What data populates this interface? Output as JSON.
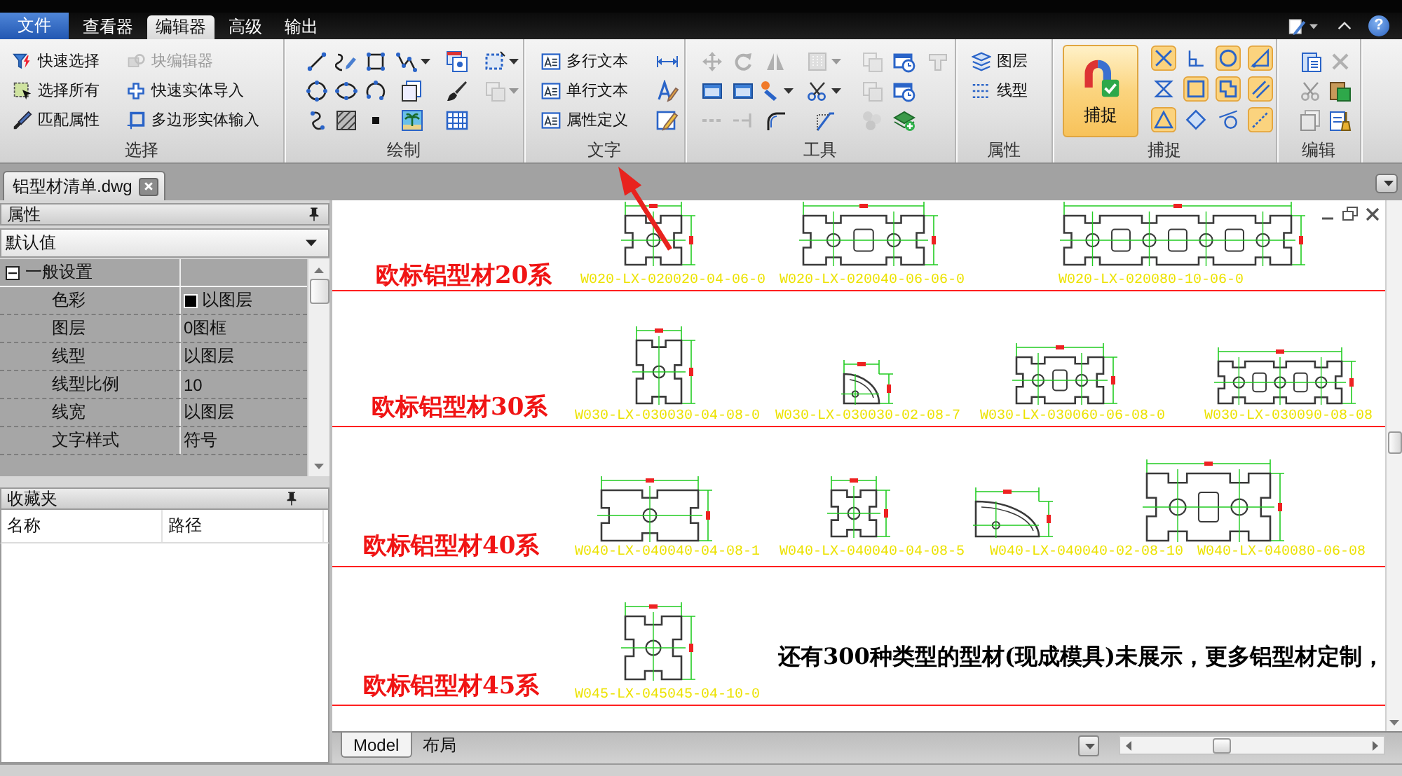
{
  "ribbon": {
    "file_menu": {
      "label": "文件"
    },
    "tabs": [
      {
        "label": "查看器",
        "selected": false
      },
      {
        "label": "编辑器",
        "selected": true
      },
      {
        "label": "高级",
        "selected": false
      },
      {
        "label": "输出",
        "selected": false
      }
    ],
    "help_button": {
      "label": "?"
    },
    "select": {
      "label": "选择",
      "buttons": [
        {
          "label": "快速选择",
          "disabled": false
        },
        {
          "label": "选择所有",
          "disabled": false
        },
        {
          "label": "匹配属性",
          "disabled": false
        },
        {
          "label": "块编辑器",
          "disabled": true
        },
        {
          "label": "快速实体导入",
          "disabled": false
        },
        {
          "label": "多边形实体输入",
          "disabled": false
        }
      ]
    },
    "draw": {
      "label": "绘制",
      "rows": [
        [
          {
            "disabled": false,
            "dropdown": false
          },
          {
            "disabled": false,
            "dropdown": false
          },
          {
            "disabled": false,
            "dropdown": false
          },
          {
            "disabled": false,
            "dropdown": true
          },
          {
            "disabled": false,
            "dropdown": false
          },
          {
            "disabled": false,
            "dropdown": true
          }
        ],
        [
          {
            "disabled": false,
            "dropdown": false
          },
          {
            "disabled": false,
            "dropdown": false
          },
          {
            "disabled": false,
            "dropdown": false
          },
          {
            "disabled": false,
            "dropdown": false
          },
          {
            "disabled": false,
            "dropdown": false
          },
          {
            "disabled": true,
            "dropdown": true
          }
        ],
        [
          {
            "disabled": false,
            "dropdown": false
          },
          {
            "disabled": false,
            "dropdown": false
          },
          {
            "disabled": false,
            "dropdown": false
          },
          {
            "disabled": false,
            "dropdown": false
          },
          {
            "disabled": false,
            "dropdown": false
          }
        ]
      ]
    },
    "text": {
      "label": "文字",
      "buttons": [
        {
          "label": "多行文本"
        },
        {
          "label": "单行文本"
        },
        {
          "label": "属性定义"
        }
      ]
    },
    "tools": {
      "label": "工具",
      "rows": [
        [
          {
            "disabled": true,
            "dropdown": false
          },
          {
            "disabled": true,
            "dropdown": false
          },
          {
            "disabled": true,
            "dropdown": false
          },
          {
            "disabled": true,
            "dropdown": true
          },
          {
            "disabled": true,
            "dropdown": false
          },
          {
            "disabled": false,
            "dropdown": false
          },
          {
            "disabled": true,
            "dropdown": false
          }
        ],
        [
          {
            "disabled": false,
            "dropdown": false
          },
          {
            "disabled": false,
            "dropdown": false
          },
          {
            "disabled": false,
            "dropdown": true
          },
          {
            "disabled": false,
            "dropdown": true
          },
          {
            "disabled": true,
            "dropdown": false
          },
          {
            "disabled": false,
            "dropdown": false
          }
        ],
        [
          {
            "disabled": true,
            "dropdown": false
          },
          {
            "disabled": true,
            "dropdown": false
          },
          {
            "disabled": false,
            "dropdown": false
          },
          {
            "disabled": false,
            "dropdown": false
          },
          {
            "disabled": true,
            "dropdown": false
          },
          {
            "disabled": false,
            "dropdown": false
          }
        ]
      ]
    },
    "properties": {
      "label": "属性",
      "buttons": [
        {
          "label": "图层"
        },
        {
          "label": "线型"
        }
      ]
    },
    "snap": {
      "label": "捕捉",
      "main_button": {
        "label": "捕捉",
        "on": true
      },
      "modes": [
        {
          "on": true
        },
        {
          "on": false
        },
        {
          "on": true
        },
        {
          "on": true
        },
        {
          "on": false
        },
        {
          "on": true
        },
        {
          "on": true
        },
        {
          "on": true
        },
        {
          "on": true
        },
        {
          "on": false
        },
        {
          "on": false
        },
        {
          "on": true
        }
      ]
    },
    "edit": {
      "label": "编辑",
      "tools": [
        {
          "disabled": false
        },
        {
          "disabled": true
        },
        {
          "disabled": true
        },
        {
          "disabled": false
        },
        {
          "disabled": true
        },
        {
          "disabled": false
        }
      ]
    }
  },
  "document_tabs": [
    {
      "label": "铝型材清单.dwg",
      "selected": true
    }
  ],
  "properties_panel": {
    "title": "属性",
    "selector": {
      "value": "默认值"
    },
    "groups": [
      {
        "label": "一般设置",
        "expanded": true,
        "rows": [
          {
            "name": "色彩",
            "value": "以图层",
            "color": "#000000"
          },
          {
            "name": "图层",
            "value": "0图框"
          },
          {
            "name": "线型",
            "value": "以图层"
          },
          {
            "name": "线型比例",
            "value": "10"
          },
          {
            "name": "线宽",
            "value": "以图层"
          },
          {
            "name": "文字样式",
            "value": "符号"
          }
        ]
      }
    ]
  },
  "favorites_panel": {
    "title": "收藏夹",
    "columns": [
      "名称",
      "路径"
    ]
  },
  "drawing": {
    "sections": [
      {
        "title": "欧标铝型材20系",
        "profiles": [
          {
            "kind": "single",
            "label": "W020-LX-020020-04-06-0"
          },
          {
            "kind": "double",
            "label": "W020-LX-020040-06-06-0"
          },
          {
            "kind": "quad",
            "label": "W020-LX-020080-10-06-0"
          }
        ]
      },
      {
        "title": "欧标铝型材30系",
        "profiles": [
          {
            "kind": "single",
            "label": "W030-LX-030030-04-08-0"
          },
          {
            "kind": "arc",
            "label": "W030-LX-030030-02-08-7"
          },
          {
            "kind": "double",
            "label": "W030-LX-030060-06-08-0"
          },
          {
            "kind": "triple",
            "label": "W030-LX-030090-08-08"
          }
        ]
      },
      {
        "title": "欧标铝型材40系",
        "profiles": [
          {
            "kind": "single",
            "label": "W040-LX-040040-04-08-1"
          },
          {
            "kind": "single",
            "label": "W040-LX-040040-04-08-5"
          },
          {
            "kind": "arc",
            "label": "W040-LX-040040-02-08-10"
          },
          {
            "kind": "double",
            "label": "W040-LX-040080-06-08"
          }
        ]
      },
      {
        "title": "欧标铝型材45系",
        "profiles": [
          {
            "kind": "single",
            "label": "W045-LX-045045-04-10-0"
          }
        ],
        "note": "还有300种类型的型材(现成模具)未展示，更多铝型材定制，"
      }
    ]
  },
  "layout_tabs": [
    {
      "label": "Model",
      "selected": true
    },
    {
      "label": "布局",
      "selected": false
    }
  ]
}
